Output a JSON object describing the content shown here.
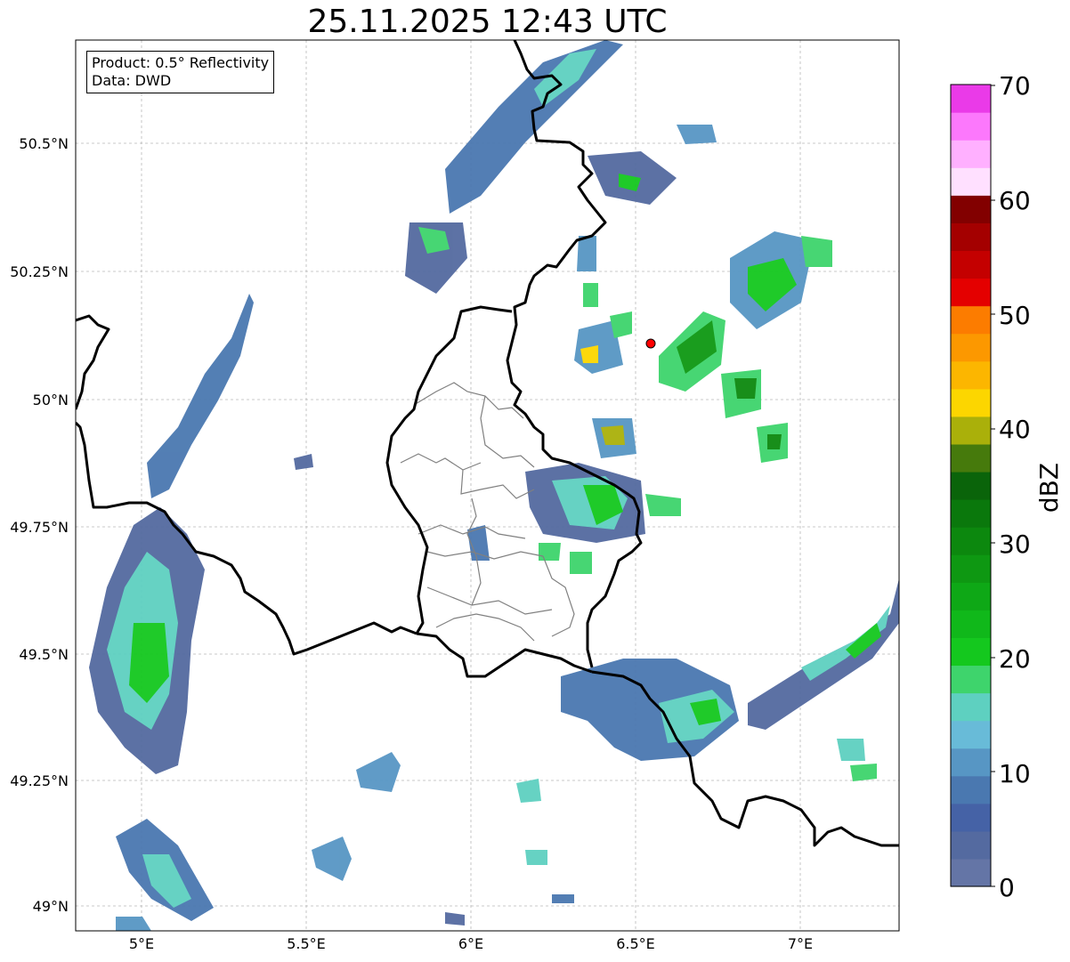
{
  "title": "25.11.2025 12:43 UTC",
  "info_box": {
    "product": "Product: 0.5° Reflectivity",
    "data": "Data: DWD"
  },
  "map": {
    "lon_range": [
      4.8,
      7.3
    ],
    "lat_range": [
      48.95,
      50.7
    ],
    "x_ticks": [
      "5°E",
      "5.5°E",
      "6°E",
      "6.5°E",
      "7°E"
    ],
    "y_ticks": [
      "50.5°N",
      "50.25°N",
      "50°N",
      "49.75°N",
      "49.5°N",
      "49.25°N",
      "49°N"
    ],
    "grid": "dashed",
    "radar_site_marker": {
      "color": "#ff0000"
    }
  },
  "colorbar": {
    "label": "dBZ",
    "min": 0,
    "max": 70,
    "ticks": [
      "70",
      "60",
      "50",
      "40",
      "30",
      "20",
      "10",
      "0"
    ],
    "colors": [
      "#6475a6",
      "#546aa0",
      "#4562a6",
      "#4a78b0",
      "#5796c4",
      "#68bbd8",
      "#5ed0c0",
      "#3ed46c",
      "#14c81e",
      "#10b81a",
      "#0ea816",
      "#0e9812",
      "#0c880e",
      "#0a780c",
      "#0a640a",
      "#467a0c",
      "#aab00a",
      "#fcd600",
      "#fcb600",
      "#fc9800",
      "#fc7c00",
      "#e40000",
      "#c40000",
      "#a40000",
      "#820000",
      "#ffe0ff",
      "#ffb0ff",
      "#fc78fc",
      "#ea3ae8"
    ]
  }
}
